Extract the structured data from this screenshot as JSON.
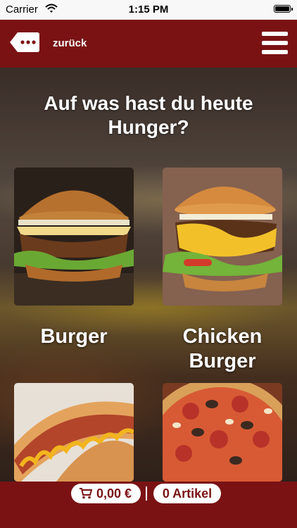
{
  "status_bar": {
    "carrier": "Carrier",
    "time": "1:15 PM"
  },
  "nav": {
    "back_label": "zurück"
  },
  "headline": "Auf was hast du heute Hunger?",
  "categories": [
    {
      "label": "Burger",
      "image": "burger-photo"
    },
    {
      "label": "Chicken Burger",
      "image": "chicken-burger-photo"
    },
    {
      "label": "",
      "image": "hotdog-photo"
    },
    {
      "label": "",
      "image": "pizza-photo"
    }
  ],
  "cart": {
    "price": "0,00 €",
    "items": "0 Artikel"
  },
  "colors": {
    "brand_red": "#7a1214",
    "white": "#ffffff"
  }
}
